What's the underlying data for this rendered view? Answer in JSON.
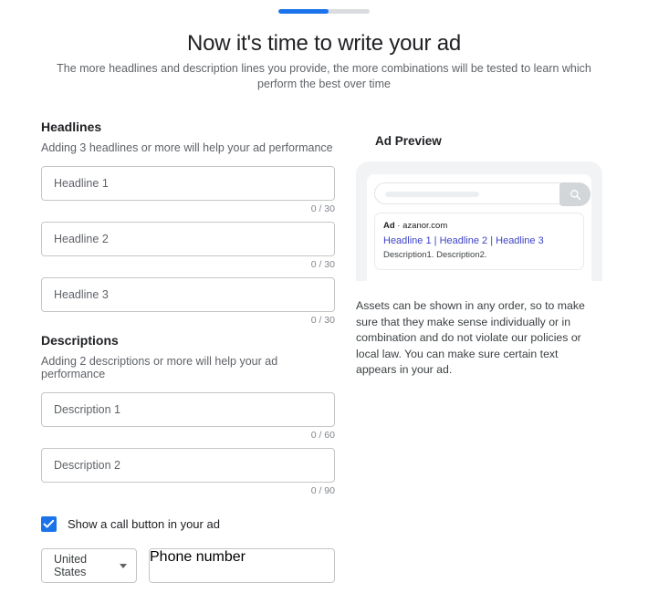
{
  "progress": {
    "percent": 55,
    "fill_color": "#1a73e8",
    "track_color": "#dadce0"
  },
  "header": {
    "title": "Now it's time to write your ad",
    "subtitle": "The more headlines and description lines you provide, the more combinations will be tested to learn which perform the best over time"
  },
  "headlines": {
    "section_title": "Headlines",
    "section_hint": "Adding 3 headlines or more will help your ad performance",
    "fields": [
      {
        "placeholder": "Headline 1",
        "counter": "0 / 30",
        "value": ""
      },
      {
        "placeholder": "Headline 2",
        "counter": "0 / 30",
        "value": ""
      },
      {
        "placeholder": "Headline 3",
        "counter": "0 / 30",
        "value": ""
      }
    ]
  },
  "descriptions": {
    "section_title": "Descriptions",
    "section_hint": "Adding 2 descriptions or more will help your ad performance",
    "fields": [
      {
        "placeholder": "Description 1",
        "counter": "0 / 60",
        "value": ""
      },
      {
        "placeholder": "Description 2",
        "counter": "0 / 90",
        "value": ""
      }
    ]
  },
  "call_button": {
    "checkbox_label": "Show a call button in your ad",
    "checked": true,
    "checkbox_color": "#1a73e8",
    "country": "United States",
    "phone_placeholder": "Phone number",
    "phone_value": ""
  },
  "preview": {
    "heading": "Ad Preview",
    "ad_label": "Ad",
    "ad_separator": "·",
    "display_url": "azanor.com",
    "headline_line": "Headline 1 | Headline 2 | Headline 3",
    "headline_parts": [
      "Headline 1",
      "Headline 2",
      "Headline 3"
    ],
    "headline_color": "#3d43c4",
    "description_line": "Description1. Description2.",
    "assets_note": "Assets can be shown in any order, so to make sure that they make sense individually or in combination and do not violate our policies or local law. You can make sure certain text appears in your ad."
  }
}
